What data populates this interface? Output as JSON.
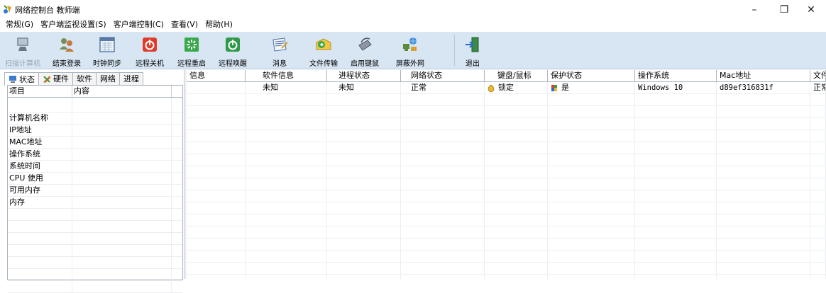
{
  "window": {
    "title": "网络控制台 教师端",
    "minimize": "–",
    "restore": "❐",
    "close": "✕"
  },
  "menu": [
    "常规(G)",
    "客户端监视设置(S)",
    "客户端控制(C)",
    "查看(V)",
    "帮助(H)"
  ],
  "toolbar": [
    {
      "label": "扫描计算机",
      "icon": "computer-scan-icon",
      "disabled": true
    },
    {
      "label": "结束登录",
      "icon": "users-logout-icon",
      "disabled": false
    },
    {
      "label": "时钟同步",
      "icon": "calendar-clock-icon",
      "disabled": false
    },
    {
      "label": "远程关机",
      "icon": "power-off-icon",
      "disabled": false
    },
    {
      "label": "远程重启",
      "icon": "restart-icon",
      "disabled": false
    },
    {
      "label": "远程唤醒",
      "icon": "wake-power-icon",
      "disabled": false
    },
    {
      "label": "消息",
      "icon": "message-icon",
      "disabled": false
    },
    {
      "label": "文件传输",
      "icon": "file-transfer-icon",
      "disabled": false
    },
    {
      "label": "启用键鼠",
      "icon": "mouse-icon",
      "disabled": false
    },
    {
      "label": "屏蔽外网",
      "icon": "network-block-icon",
      "disabled": false
    },
    {
      "label": "退出",
      "icon": "exit-door-icon",
      "disabled": false
    }
  ],
  "colors": {
    "toolbar_bg": "#d8e6f4",
    "power_red": "#e03b2a",
    "restart_green": "#38a84a",
    "border": "#a9b4c2"
  },
  "left_tabs": [
    {
      "label": "状态",
      "icon": "status-icon"
    },
    {
      "label": "硬件",
      "icon": "hardware-icon"
    },
    {
      "label": "软件",
      "icon": ""
    },
    {
      "label": "网络",
      "icon": ""
    },
    {
      "label": "进程",
      "icon": ""
    }
  ],
  "left_table": {
    "headers": [
      "项目",
      "内容"
    ],
    "rows": [
      [
        "计算机名称",
        ""
      ],
      [
        "IP地址",
        ""
      ],
      [
        "MAC地址",
        ""
      ],
      [
        "操作系统",
        ""
      ],
      [
        "系统时间",
        ""
      ],
      [
        "CPU 使用",
        ""
      ],
      [
        "可用内存",
        ""
      ],
      [
        "内存",
        ""
      ]
    ]
  },
  "right_table": {
    "headers": [
      "信息",
      "软件信息",
      "进程状态",
      "网络状态",
      "键盘/鼠标",
      "保护状态",
      "操作系统",
      "Mac地址",
      "文件传"
    ],
    "rows": [
      [
        "",
        "未知",
        "未知",
        "正常",
        "锁定",
        "是",
        "Windows 10",
        "d89ef316831f",
        "正常"
      ]
    ]
  }
}
